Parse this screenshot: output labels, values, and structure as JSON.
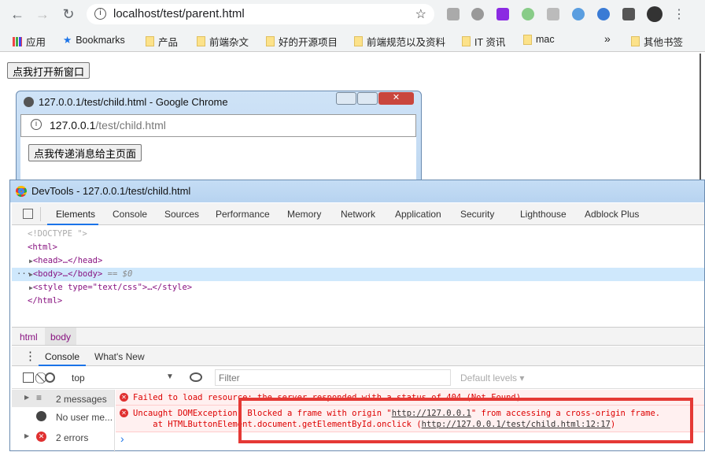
{
  "browser": {
    "url": "localhost/test/parent.html",
    "back": "←",
    "forward": "→",
    "reload": "↻",
    "star": "☆",
    "menu": "⋮",
    "bookmarks": [
      {
        "label": "应用",
        "icon": "apps-grid-icon"
      },
      {
        "label": "Bookmarks",
        "icon": "star-icon"
      },
      {
        "label": "产品"
      },
      {
        "label": "前端杂文"
      },
      {
        "label": "好的开源项目"
      },
      {
        "label": "前端规范以及资料"
      },
      {
        "label": "IT 资讯"
      },
      {
        "label": "mac"
      }
    ],
    "more": "»",
    "other_bookmarks": "其他书签"
  },
  "page": {
    "open_button": "点我打开新窗口"
  },
  "child": {
    "title": "127.0.0.1/test/child.html - Google Chrome",
    "url_host": "127.0.0.1",
    "url_path": "/test/child.html",
    "button": "点我传递消息给主页面"
  },
  "devtools": {
    "title": "DevTools - 127.0.0.1/test/child.html",
    "tabs": [
      "Elements",
      "Console",
      "Sources",
      "Performance",
      "Memory",
      "Network",
      "Application",
      "Security",
      "Lighthouse",
      "Adblock Plus"
    ],
    "active_tab": "Elements",
    "dom": [
      "<!DOCTYPE \">",
      "<html>",
      "<head>…</head>",
      "<body>…</body>",
      "== $0",
      "<style type=\"text/css\">…</style>",
      "</html>"
    ],
    "breadcrumbs": [
      "html",
      "body"
    ],
    "drawer_tabs": [
      "Console",
      "What's New"
    ],
    "context": "top",
    "filter_placeholder": "Filter",
    "levels": "Default levels ▾",
    "sidebar": [
      {
        "label": "2 messages"
      },
      {
        "label": "No user me..."
      },
      {
        "label": "2 errors"
      }
    ],
    "messages": [
      {
        "text": "Failed to load resource: the server responded with a status of 404 (Not Found)"
      },
      {
        "text_pre": "Uncaught DOMException: Blocked a frame with origin \"",
        "link1": "http://127.0.0.1",
        "text_post": "\" from accessing a cross-origin frame.",
        "stack_pre": "    at HTMLButtonElement.document.getElementById.onclick (",
        "link2": "http://127.0.0.1/test/child.html:12:17",
        "stack_post": ")"
      }
    ],
    "prompt": "›"
  },
  "colors": {
    "highlight_box": "#e53935",
    "error_text": "#d00000",
    "error_bg": "#fff0f0",
    "selected_row": "#cfe8fc",
    "active_tab_underline": "#1a73e8"
  }
}
